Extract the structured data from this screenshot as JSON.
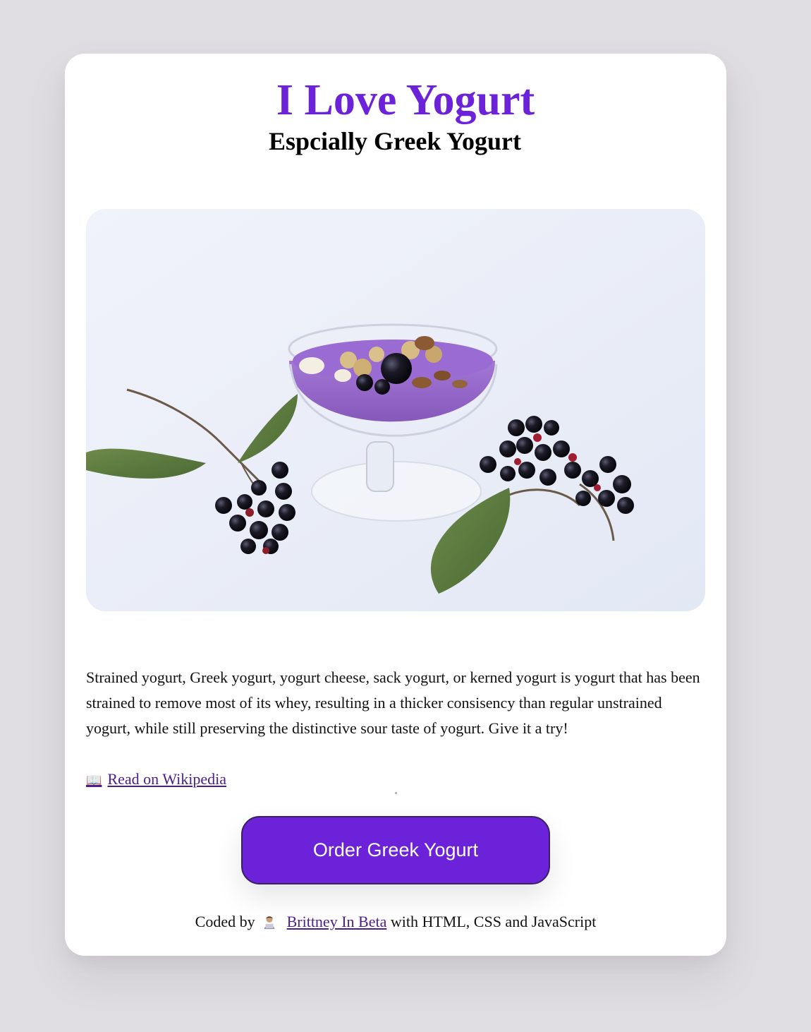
{
  "page": {
    "title": "I Love Yogurt",
    "subtitle": "Espcially Greek Yogurt"
  },
  "hero_image": {
    "icon": "yogurt-bowl-photo"
  },
  "content": {
    "description": "Strained yogurt, Greek yogurt, yogurt cheese, sack yogurt, or kerned yogurt is yogurt that has been strained to remove most of its whey, resulting in a thicker consisency than regular unstrained yogurt, while still preserving the distinctive sour taste of yogurt. Give it a try!",
    "wiki_link": {
      "icon": "📖",
      "label": "Read on Wikipedia"
    }
  },
  "actions": {
    "order_label": "Order Greek Yogurt"
  },
  "footer": {
    "prefix": "Coded by",
    "icon": "technologist-icon",
    "author": "Brittney In Beta",
    "suffix": "with HTML, CSS and JavaScript"
  },
  "colors": {
    "accent": "#6c22d9",
    "background": "#dfdde2",
    "link": "#4b1e8a"
  }
}
